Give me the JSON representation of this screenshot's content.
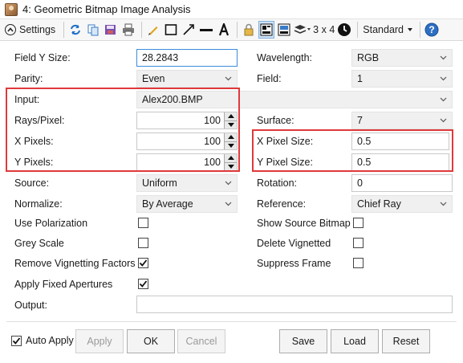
{
  "window": {
    "title": "4: Geometric Bitmap Image Analysis"
  },
  "toolbar": {
    "settings_label": "Settings",
    "grid_label": "3 x 4",
    "standard_label": "Standard",
    "icons": [
      "refresh-icon",
      "copy-icon",
      "save-icon",
      "print-icon",
      "pencil-icon",
      "rectangle-icon",
      "line-arrow-icon",
      "line-icon",
      "text-icon",
      "lock-icon",
      "window-layout-icon",
      "window-layout-alt-icon",
      "layers-icon",
      "grid-icon",
      "timer-icon",
      "help-icon"
    ]
  },
  "form": {
    "field_y_size": {
      "label": "Field Y Size:",
      "value": "28.2843"
    },
    "wavelength": {
      "label": "Wavelength:",
      "value": "RGB"
    },
    "parity": {
      "label": "Parity:",
      "value": "Even"
    },
    "field": {
      "label": "Field:",
      "value": "1"
    },
    "input": {
      "label": "Input:",
      "value": "Alex200.BMP"
    },
    "rays_per_pixel": {
      "label": "Rays/Pixel:",
      "value": "100"
    },
    "surface": {
      "label": "Surface:",
      "value": "7"
    },
    "x_pixels": {
      "label": "X Pixels:",
      "value": "100"
    },
    "x_pixel_size": {
      "label": "X Pixel Size:",
      "value": "0.5"
    },
    "y_pixels": {
      "label": "Y Pixels:",
      "value": "100"
    },
    "y_pixel_size": {
      "label": "Y Pixel Size:",
      "value": "0.5"
    },
    "source": {
      "label": "Source:",
      "value": "Uniform"
    },
    "rotation": {
      "label": "Rotation:",
      "value": "0"
    },
    "normalize": {
      "label": "Normalize:",
      "value": "By Average"
    },
    "reference": {
      "label": "Reference:",
      "value": "Chief Ray"
    },
    "use_polarization": {
      "label": "Use Polarization",
      "checked": false
    },
    "show_source_bitmap": {
      "label": "Show Source Bitmap",
      "checked": false
    },
    "grey_scale": {
      "label": "Grey Scale",
      "checked": false
    },
    "delete_vignetted": {
      "label": "Delete Vignetted",
      "checked": false
    },
    "remove_vignetting_factors": {
      "label": "Remove Vignetting Factors",
      "checked": true
    },
    "suppress_frame": {
      "label": "Suppress Frame",
      "checked": false
    },
    "apply_fixed_apertures": {
      "label": "Apply Fixed Apertures",
      "checked": true
    },
    "output": {
      "label": "Output:",
      "value": ""
    }
  },
  "footer": {
    "auto_apply": {
      "label": "Auto Apply",
      "checked": true
    },
    "apply_label": "Apply",
    "ok_label": "OK",
    "cancel_label": "Cancel",
    "save_label": "Save",
    "load_label": "Load",
    "reset_label": "Reset"
  },
  "colors": {
    "highlight": "#e0393b",
    "accent": "#3b8ddb"
  }
}
